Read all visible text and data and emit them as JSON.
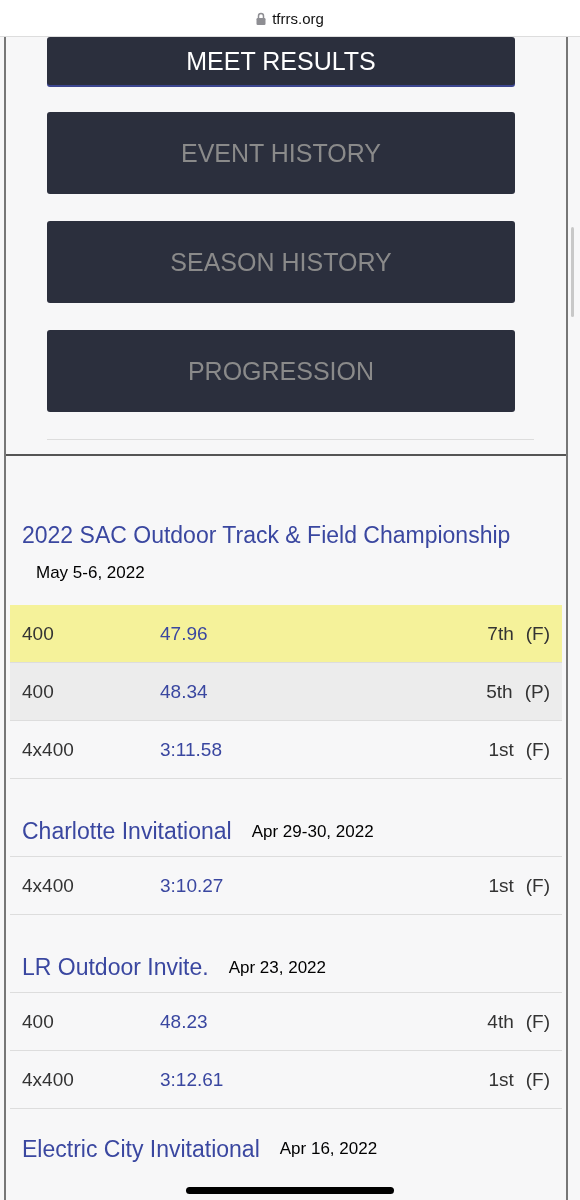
{
  "address_bar": {
    "url": "tfrrs.org"
  },
  "nav_buttons": [
    {
      "label": "MEET RESULTS",
      "selected": true
    },
    {
      "label": "EVENT HISTORY",
      "selected": false
    },
    {
      "label": "SEASON HISTORY",
      "selected": false
    },
    {
      "label": "PROGRESSION",
      "selected": false
    }
  ],
  "meets": [
    {
      "name": "2022 SAC Outdoor Track & Field Championship",
      "date": "May 5-6, 2022",
      "results": [
        {
          "event": "400",
          "mark": "47.96",
          "place": "7th",
          "round": "(F)",
          "color": "#f5f29a"
        },
        {
          "event": "400",
          "mark": "48.34",
          "place": "5th",
          "round": "(P)",
          "color": "#ececec"
        },
        {
          "event": "4x400",
          "mark": "3:11.58",
          "place": "1st",
          "round": "(F)"
        }
      ]
    },
    {
      "name": "Charlotte Invitational",
      "date": "Apr 29-30, 2022",
      "results": [
        {
          "event": "4x400",
          "mark": "3:10.27",
          "place": "1st",
          "round": "(F)"
        }
      ]
    },
    {
      "name": "LR Outdoor Invite.",
      "date": "Apr 23, 2022",
      "results": [
        {
          "event": "400",
          "mark": "48.23",
          "place": "4th",
          "round": "(F)"
        },
        {
          "event": "4x400",
          "mark": "3:12.61",
          "place": "1st",
          "round": "(F)"
        }
      ]
    },
    {
      "name": "Electric City Invitational",
      "date": "Apr 16, 2022"
    }
  ]
}
